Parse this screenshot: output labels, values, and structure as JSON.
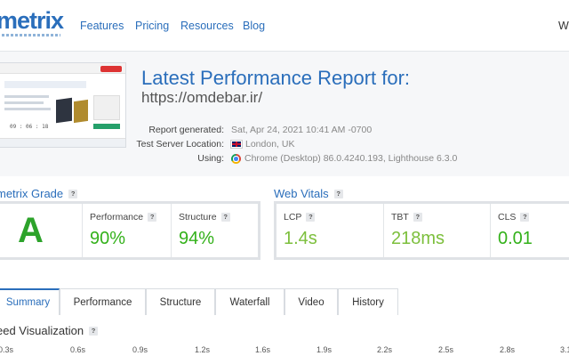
{
  "header": {
    "logo": "metrix",
    "nav": [
      "Features",
      "Pricing",
      "Resources",
      "Blog"
    ],
    "nav_right": "Wi"
  },
  "report": {
    "title": "Latest Performance Report for:",
    "url": "https://omdebar.ir/",
    "thumb_nums": "09 : 06 : 18",
    "meta": [
      {
        "label": "Report generated:",
        "value": "Sat, Apr 24, 2021 10:41 AM -0700",
        "icon": ""
      },
      {
        "label": "Test Server Location:",
        "value": "London, UK",
        "icon": "uk-flag-icon"
      },
      {
        "label": "Using:",
        "value": "Chrome (Desktop) 86.0.4240.193, Lighthouse 6.3.0",
        "icon": "chrome-icon"
      }
    ]
  },
  "grade": {
    "title": "metrix Grade",
    "letter": "A",
    "performance_label": "Performance",
    "performance_value": "90%",
    "structure_label": "Structure",
    "structure_value": "94%"
  },
  "vitals": {
    "title": "Web Vitals",
    "items": [
      {
        "label": "LCP",
        "value": "1.4s"
      },
      {
        "label": "TBT",
        "value": "218ms"
      },
      {
        "label": "CLS",
        "value": "0.01"
      }
    ]
  },
  "tabs": [
    "Summary",
    "Performance",
    "Structure",
    "Waterfall",
    "Video",
    "History"
  ],
  "speed": {
    "title": "eed Visualization",
    "ticks": [
      "0.3s",
      "0.6s",
      "0.9s",
      "1.2s",
      "1.6s",
      "1.9s",
      "2.2s",
      "2.5s",
      "2.8s",
      "3.1"
    ]
  },
  "colors": {
    "brand": "#2a6ebb",
    "good": "#33b11a",
    "ok": "#7cbf3c"
  }
}
